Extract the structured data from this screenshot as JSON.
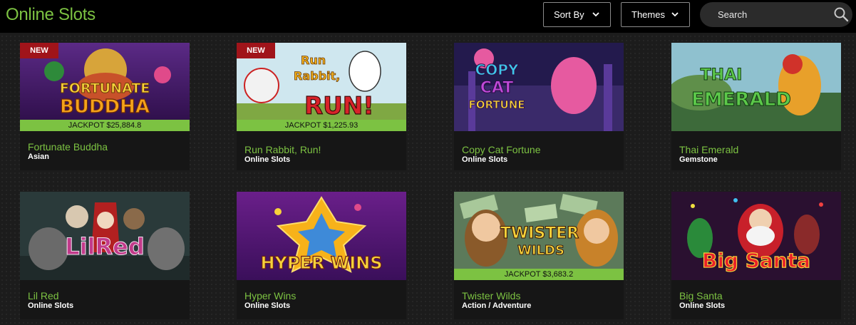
{
  "header": {
    "title": "Online Slots",
    "sort_label": "Sort By",
    "themes_label": "Themes",
    "search_placeholder": "Search"
  },
  "icons": {
    "sort_chevron": "chevron-down-icon",
    "themes_chevron": "chevron-down-icon",
    "search": "search-icon"
  },
  "colors": {
    "accent_green": "#7cc242",
    "new_badge": "#a0141a",
    "background": "#1c1c1c"
  },
  "games": [
    {
      "title": "Fortunate Buddha",
      "category": "Asian",
      "badge": "NEW",
      "jackpot": "JACKPOT $25,884.8",
      "art_lines": [
        "FORTUNATE",
        "BUDDHA"
      ]
    },
    {
      "title": "Run Rabbit, Run!",
      "category": "Online Slots",
      "badge": "NEW",
      "jackpot": "JACKPOT $1,225.93",
      "art_lines": [
        "Run",
        "Rabbit,",
        "RUN!"
      ]
    },
    {
      "title": "Copy Cat Fortune",
      "category": "Online Slots",
      "badge": "",
      "jackpot": "",
      "art_lines": [
        "COPY",
        "CAT",
        "FORTUNE"
      ]
    },
    {
      "title": "Thai Emerald",
      "category": "Gemstone",
      "badge": "",
      "jackpot": "",
      "art_lines": [
        "THAI",
        "EMERALD"
      ]
    },
    {
      "title": "Lil Red",
      "category": "Online Slots",
      "badge": "",
      "jackpot": "",
      "art_lines": [
        "LilRed"
      ]
    },
    {
      "title": "Hyper Wins",
      "category": "Online Slots",
      "badge": "",
      "jackpot": "",
      "art_lines": [
        "HYPER WINS"
      ]
    },
    {
      "title": "Twister Wilds",
      "category": "Action / Adventure",
      "badge": "",
      "jackpot": "JACKPOT $3,683.2",
      "art_lines": [
        "TWISTER",
        "WILDS"
      ]
    },
    {
      "title": "Big Santa",
      "category": "Online Slots",
      "badge": "",
      "jackpot": "",
      "art_lines": [
        "Big Santa"
      ]
    }
  ]
}
